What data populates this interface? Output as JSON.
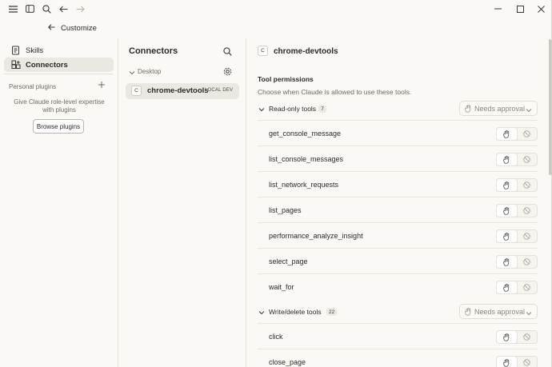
{
  "window": {
    "back_label": "Customize"
  },
  "sidebar": {
    "items": [
      {
        "label": "Skills"
      },
      {
        "label": "Connectors"
      }
    ],
    "personal_plugins": {
      "heading": "Personal plugins",
      "description_line1": "Give Claude role-level expertise",
      "description_line2": "with plugins",
      "browse_button": "Browse plugins"
    }
  },
  "connectors": {
    "title": "Connectors",
    "section": "Desktop",
    "items": [
      {
        "badge": "C",
        "name": "chrome-devtools",
        "tag": "LOCAL DEV"
      }
    ]
  },
  "detail": {
    "badge": "C",
    "title": "chrome-devtools",
    "permissions_heading": "Tool permissions",
    "permissions_desc": "Choose when Claude is allowed to use these tools.",
    "groups": [
      {
        "label": "Read-only tools",
        "count": "7",
        "approval": "Needs approval",
        "tools": [
          "get_console_message",
          "list_console_messages",
          "list_network_requests",
          "list_pages",
          "performance_analyze_insight",
          "select_page",
          "wait_for"
        ]
      },
      {
        "label": "Write/delete tools",
        "count": "22",
        "approval": "Needs approval",
        "tools": [
          "click",
          "close_page"
        ]
      }
    ]
  },
  "colors": {
    "background": "#faf9f5",
    "active_item": "#eae8e1",
    "text": "#2b2a27",
    "muted": "#8a8880"
  }
}
